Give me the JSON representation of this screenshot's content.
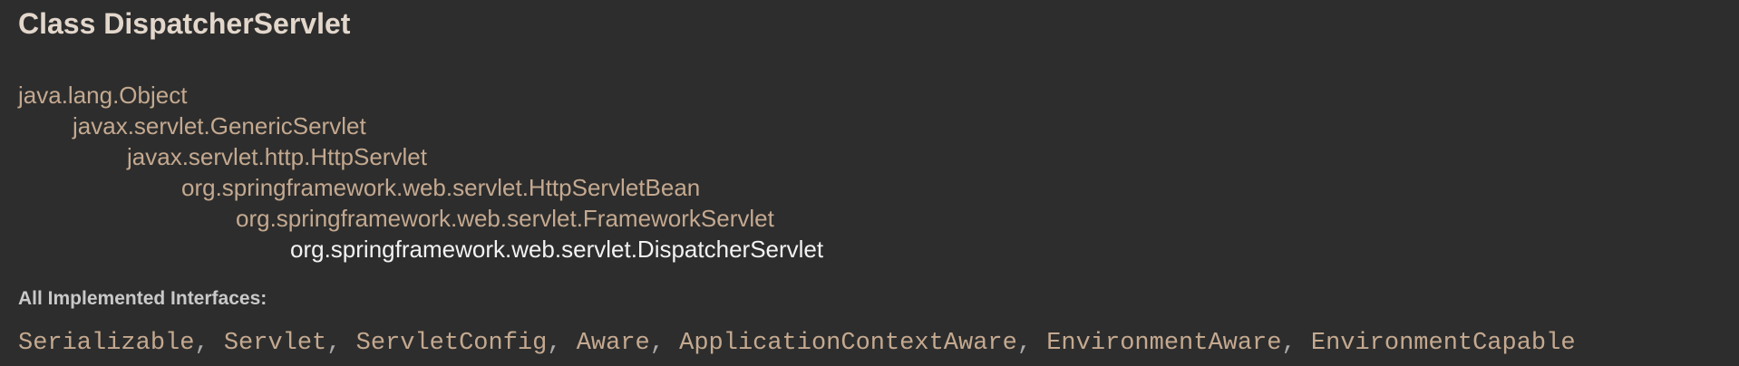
{
  "title": "Class DispatcherServlet",
  "hierarchy": [
    {
      "name": "java.lang.Object",
      "current": false
    },
    {
      "name": "javax.servlet.GenericServlet",
      "current": false
    },
    {
      "name": "javax.servlet.http.HttpServlet",
      "current": false
    },
    {
      "name": "org.springframework.web.servlet.HttpServletBean",
      "current": false
    },
    {
      "name": "org.springframework.web.servlet.FrameworkServlet",
      "current": false
    },
    {
      "name": "org.springframework.web.servlet.DispatcherServlet",
      "current": true
    }
  ],
  "interfaces": {
    "label": "All Implemented Interfaces:",
    "separator": ", ",
    "items": [
      "Serializable",
      "Servlet",
      "ServletConfig",
      "Aware",
      "ApplicationContextAware",
      "EnvironmentAware",
      "EnvironmentCapable"
    ]
  },
  "colors": {
    "background": "#2d2d2d",
    "link": "#c4a990",
    "title": "#e3d7cc",
    "current": "#f2f2f2",
    "label": "#c9c9c9"
  }
}
